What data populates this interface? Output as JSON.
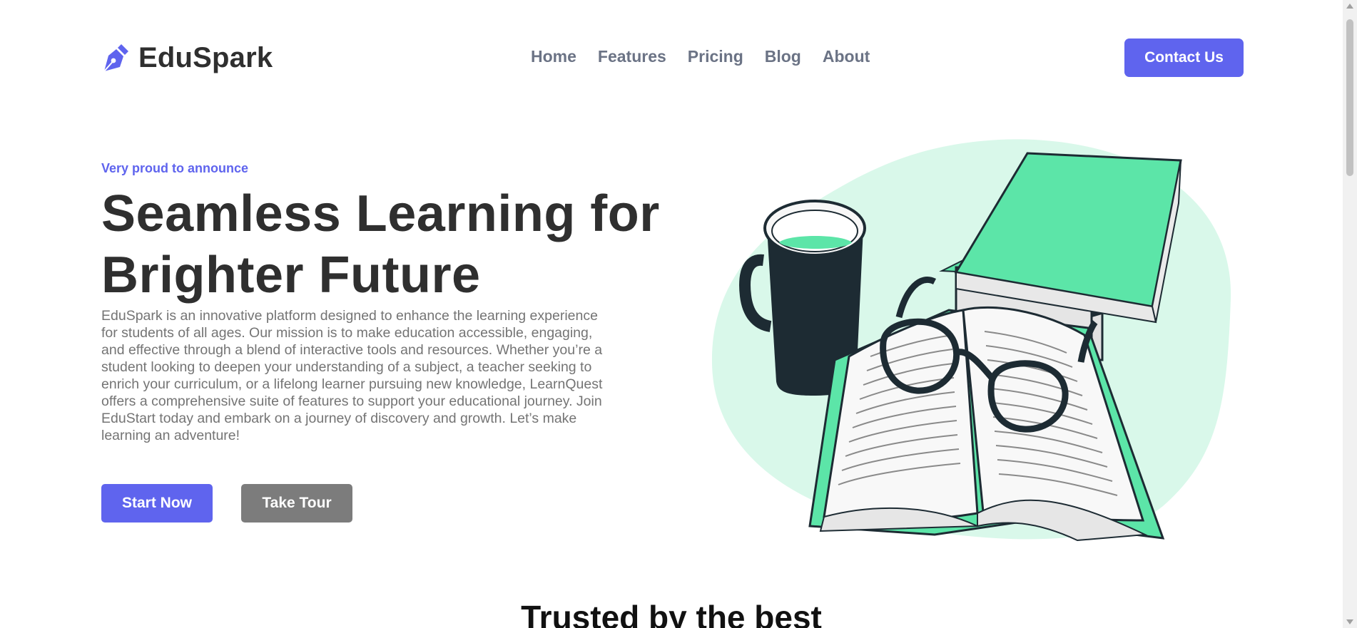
{
  "header": {
    "brand": "EduSpark",
    "nav": [
      "Home",
      "Features",
      "Pricing",
      "Blog",
      "About"
    ],
    "contact_label": "Contact Us"
  },
  "hero": {
    "eyebrow": "Very proud to announce",
    "title_line1": "Seamless Learning for",
    "title_line2": "Brighter Future",
    "description": "EduSpark is an innovative platform designed to enhance the learning experience for students of all ages. Our mission is to make education accessible, engaging, and effective through a blend of interactive tools and resources. Whether you’re a student looking to deepen your understanding of a subject, a teacher seeking to enrich your curriculum, or a lifelong learner pursuing new knowledge, LearnQuest offers a comprehensive suite of features to support your educational journey. Join EduStart today and embark on a journey of discovery and growth. Let’s make learning an adventure!",
    "primary_label": "Start Now",
    "secondary_label": "Take Tour"
  },
  "trusted": {
    "heading": "Trusted by the best"
  },
  "colors": {
    "accent": "#5f64ee",
    "secondary_button": "#7c7c7c",
    "illustration_green": "#5ce5a8",
    "illustration_blob": "#d9f8ea",
    "illustration_dark": "#1d2b33"
  },
  "icons": {
    "logo": "pen-nib-icon"
  }
}
